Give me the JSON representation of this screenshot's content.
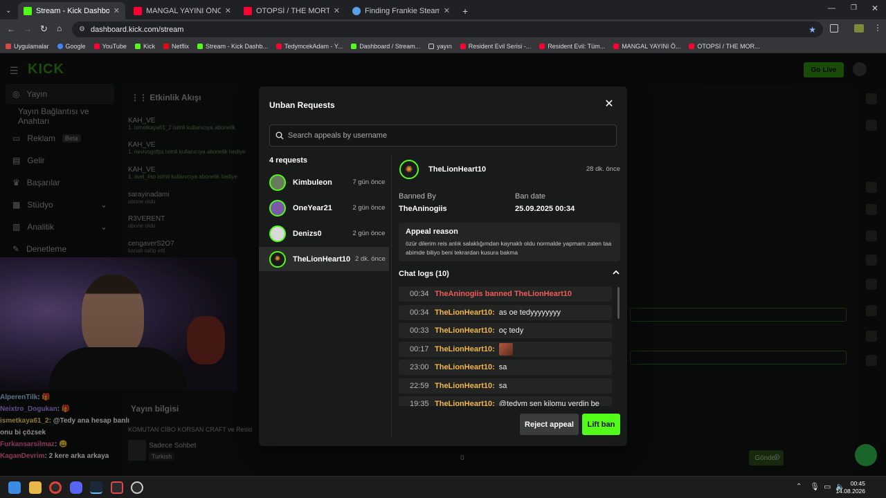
{
  "browser": {
    "tabs": [
      {
        "title": "Stream - Kick Dashboard",
        "color": "#53fc18"
      },
      {
        "title": "MANGAL YAYINI ÖNCESİ MEKİ",
        "color": "#ff0033"
      },
      {
        "title": "OTOPSİ / THE MORTUARY ASS",
        "color": "#ff0033"
      },
      {
        "title": "Finding Frankie Steam'de",
        "color": "#5aa0e6"
      }
    ],
    "url": "dashboard.kick.com/stream",
    "bookmarks": [
      "Uygulamalar",
      "Google",
      "YouTube",
      "Kick",
      "Netflix",
      "Stream - Kick Dashb...",
      "TedymcekAdam - Y...",
      "Dashboard / Stream...",
      "yayın",
      "Resident Evil Serisi -...",
      "Resident Evil: Tüm...",
      "MANGAL YAYINI Ö...",
      "OTOPSİ / THE MOR..."
    ]
  },
  "dashboard": {
    "logo": "KICK",
    "go_live": "Go Live",
    "sidebar": [
      "Yayın",
      "Yayın Bağlantısı ve Anahtarı",
      "Reklam",
      "Gelir",
      "Başarılar",
      "Stüdyo",
      "Analitik",
      "Denetleme"
    ],
    "sidebar_badge": "Beta",
    "feed_title": "Etkinlik Akışı",
    "feed": [
      {
        "name": "KAH_VE",
        "sub": "1. ismetkaya61_2 isimli kullanıcıya abonelik"
      },
      {
        "name": "KAH_VE",
        "sub": "1. nevivogofps isimli kullanıcıya abonelik hediye"
      },
      {
        "name": "KAH_VE",
        "sub": "1. avel_ilso isimli kullanıcıya abonelik hediye"
      },
      {
        "name": "sarayinadami",
        "sub": "abone oldu"
      },
      {
        "name": "R3VERENT",
        "sub": "abone oldu"
      },
      {
        "name": "cengaverS2O7",
        "sub": "kanalı takip etti"
      }
    ],
    "stream_info_title": "Yayın bilgisi",
    "stream_title": "KOMUTAN CİBO KORSAN CRAFT ve Resid",
    "category": "Sadece Sohbet",
    "language": "Turkish",
    "send": "Gönder",
    "viewers": "0"
  },
  "overlay_chat": [
    {
      "user": "AlperenTilk",
      "color": "#a6d0ff",
      "text": ": 🎁"
    },
    {
      "user": "Neixtro_Dogukan",
      "color": "#b38cff",
      "text": ": 🎁"
    },
    {
      "user": "ismetkaya61_2",
      "color": "#ffd866",
      "text": ": @Tedy ana hesap banlı onu bi çözsek"
    },
    {
      "user": "Furkansarsilmaz",
      "color": "#ff5fa8",
      "text": ": 😀"
    },
    {
      "user": "KaganDevrim",
      "color": "#ff6b9d",
      "text": ": 2 kere arka arkaya"
    }
  ],
  "modal": {
    "title": "Unban Requests",
    "search_placeholder": "Search appeals by username",
    "count_label": "4 requests",
    "requests": [
      {
        "user": "Kimbuleon",
        "ago": "7 gün önce"
      },
      {
        "user": "OneYear21",
        "ago": "2 gün önce"
      },
      {
        "user": "Denizs0",
        "ago": "2 gün önce"
      },
      {
        "user": "TheLionHeart10",
        "ago": "2 dk. önce"
      }
    ],
    "detail": {
      "user": "TheLionHeart10",
      "ago": "28 dk. önce",
      "banned_by_label": "Banned By",
      "banned_by": "TheAninogiis",
      "ban_date_label": "Ban date",
      "ban_date": "25.09.2025 00:34",
      "appeal_label": "Appeal reason",
      "appeal_text": "özür dilerim reis anlık salaklığımdan kaynaklı oldu normalde yapmam zaten taa abimde biliyo beni tekrardan kusura bakma",
      "chat_logs_label": "Chat logs (10)",
      "logs": [
        {
          "time": "00:34",
          "who": "TheAninogiis banned TheLionHeart10",
          "msg": "",
          "type": "ban"
        },
        {
          "time": "00:34",
          "who": "TheLionHeart10:",
          "msg": "as oe tedyyyyyyyy",
          "type": "msg"
        },
        {
          "time": "00:33",
          "who": "TheLionHeart10:",
          "msg": "oç tedy",
          "type": "msg"
        },
        {
          "time": "00:17",
          "who": "TheLionHeart10:",
          "msg": "",
          "type": "emote"
        },
        {
          "time": "23:00",
          "who": "TheLionHeart10:",
          "msg": "sa",
          "type": "msg"
        },
        {
          "time": "22:59",
          "who": "TheLionHeart10:",
          "msg": "sa",
          "type": "msg"
        },
        {
          "time": "19:35",
          "who": "TheLionHeart10:",
          "msg": "@tedym sen kilomu verdin be",
          "type": "msg"
        }
      ]
    },
    "reject_label": "Reject appeal",
    "lift_label": "Lift ban"
  },
  "taskbar": {
    "time": "00:45",
    "date": "14.08.2026"
  }
}
